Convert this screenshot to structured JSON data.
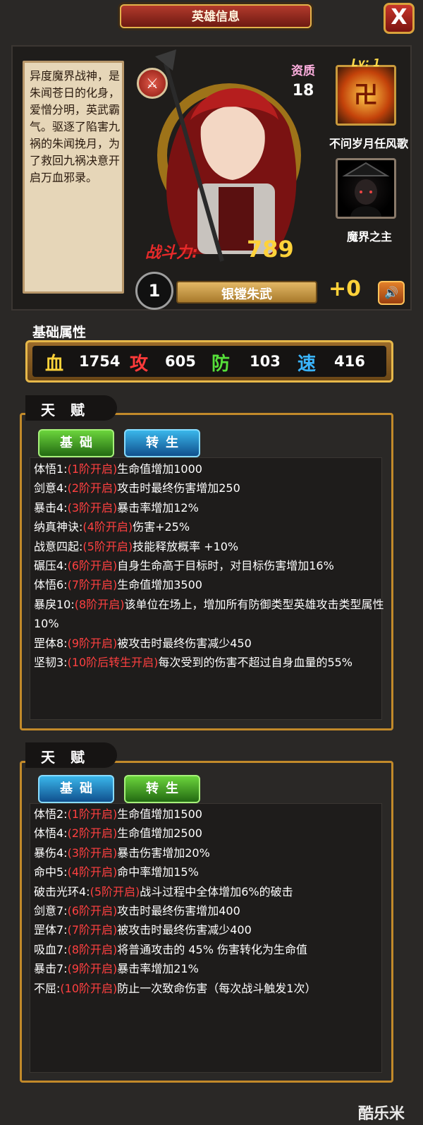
{
  "window": {
    "title": "英雄信息",
    "close_label": "X"
  },
  "hero": {
    "description": "异度魔界战神，是朱闻苍日的化身，爱憎分明，英武霸气。驱逐了陷害九祸的朱闻挽月，为了救回九祸决意开启万血邪录。",
    "aptitude_label": "资质",
    "aptitude_value": "18",
    "power_label": "战斗力:",
    "power_value": "789",
    "star_level": "1",
    "name": "银镗朱武",
    "plus": "+0",
    "skills": [
      {
        "level_label": "Lv: 1",
        "name": "不问岁月任风歌",
        "icon": "fire-seal-icon"
      },
      {
        "name": "魔界之主",
        "icon": "hooded-figure-icon"
      }
    ]
  },
  "attributes": {
    "title": "基础属性",
    "items": [
      {
        "label": "血",
        "value": "1754",
        "color": "#ffd23a"
      },
      {
        "label": "攻",
        "value": "605",
        "color": "#ff3a3a"
      },
      {
        "label": "防",
        "value": "103",
        "color": "#56e03a"
      },
      {
        "label": "速",
        "value": "416",
        "color": "#3ab4ff"
      }
    ]
  },
  "talents": [
    {
      "title": "天赋",
      "tabs": [
        {
          "label": "基础",
          "color": "green"
        },
        {
          "label": "转生",
          "color": "blue"
        }
      ],
      "lines": [
        {
          "name": "体悟1:",
          "lvl": "(1阶开启)",
          "desc": "生命值增加1000"
        },
        {
          "name": "剑意4:",
          "lvl": "(2阶开启)",
          "desc": "攻击时最终伤害增加250"
        },
        {
          "name": "暴击4:",
          "lvl": "(3阶开启)",
          "desc": "暴击率增加12%"
        },
        {
          "name": "纳真神诀:",
          "lvl": "(4阶开启)",
          "desc": "伤害+25%"
        },
        {
          "name": "战意四起:",
          "lvl": "(5阶开启)",
          "desc": "技能释放概率 +10%"
        },
        {
          "name": "碾压4:",
          "lvl": "(6阶开启)",
          "desc": "自身生命高于目标时，对目标伤害增加16%"
        },
        {
          "name": "体悟6:",
          "lvl": "(7阶开启)",
          "desc": "生命值增加3500"
        },
        {
          "name": "暴戾10:",
          "lvl": "(8阶开启)",
          "desc": "该单位在场上，增加所有防御类型英雄攻击类型属性10%"
        },
        {
          "name": "罡体8:",
          "lvl": "(9阶开启)",
          "desc": "被攻击时最终伤害减少450"
        },
        {
          "name": "坚韧3:",
          "lvl": "(10阶后转生开启)",
          "desc": "每次受到的伤害不超过自身血量的55%"
        }
      ]
    },
    {
      "title": "天赋",
      "tabs": [
        {
          "label": "基础",
          "color": "blue"
        },
        {
          "label": "转生",
          "color": "green"
        }
      ],
      "lines": [
        {
          "name": "体悟2:",
          "lvl": "(1阶开启)",
          "desc": "生命值增加1500"
        },
        {
          "name": "体悟4:",
          "lvl": "(2阶开启)",
          "desc": "生命值增加2500"
        },
        {
          "name": "暴伤4:",
          "lvl": "(3阶开启)",
          "desc": "暴击伤害增加20%"
        },
        {
          "name": "命中5:",
          "lvl": "(4阶开启)",
          "desc": "命中率增加15%"
        },
        {
          "name": "破击光环4:",
          "lvl": "(5阶开启)",
          "desc": "战斗过程中全体增加6%的破击"
        },
        {
          "name": "剑意7:",
          "lvl": "(6阶开启)",
          "desc": "攻击时最终伤害增加400"
        },
        {
          "name": "罡体7:",
          "lvl": "(7阶开启)",
          "desc": "被攻击时最终伤害减少400"
        },
        {
          "name": "吸血7:",
          "lvl": "(8阶开启)",
          "desc": "将普通攻击的 45% 伤害转化为生命值"
        },
        {
          "name": "暴击7:",
          "lvl": "(9阶开启)",
          "desc": "暴击率增加21%"
        },
        {
          "name": "不屈:",
          "lvl": "(10阶开启)",
          "desc": "防止一次致命伤害（每次战斗触发1次）"
        }
      ]
    }
  ],
  "watermark": "酷乐米"
}
